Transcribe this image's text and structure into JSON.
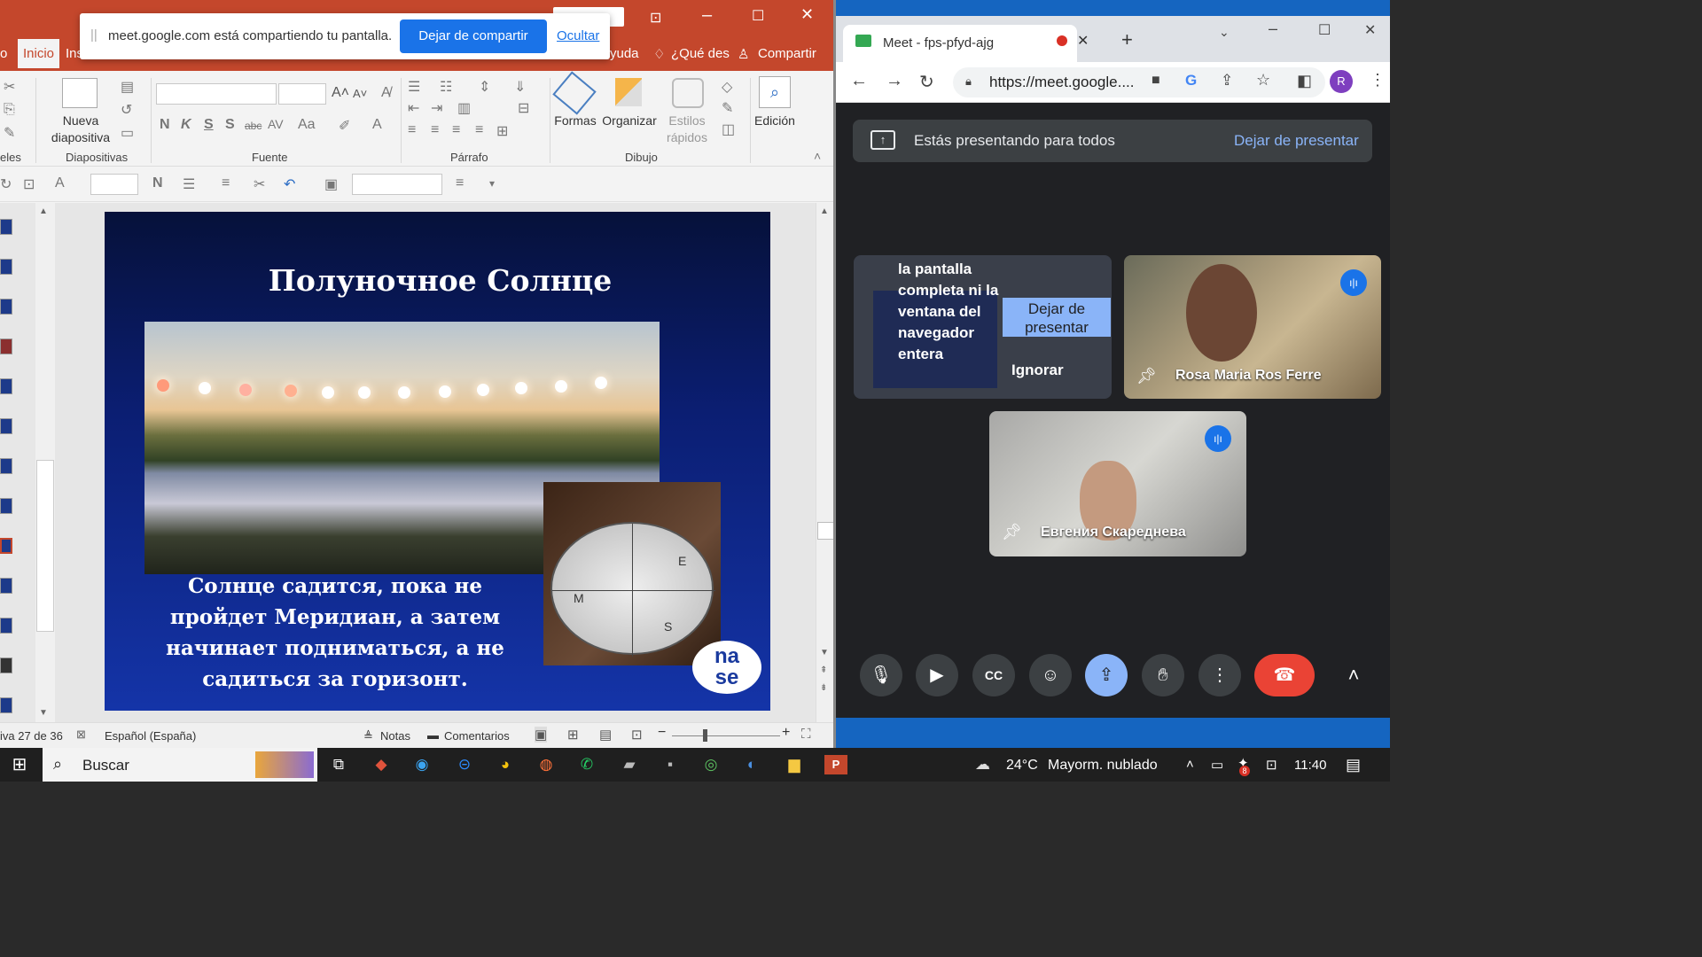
{
  "share_banner": {
    "message": "meet.google.com está compartiendo tu pantalla.",
    "stop_label": "Dejar de compartir",
    "hide_label": "Ocultar"
  },
  "ppt": {
    "tabs": [
      "o",
      "Inicio",
      "Ins",
      "yuda",
      "¿Qué des",
      "Compartir"
    ],
    "ribbon": {
      "new_slide": "Nueva diapositiva",
      "groups": [
        "eles",
        "Diapositivas",
        "Fuente",
        "Párrafo",
        "Dibujo"
      ],
      "shapes": "Formas",
      "arrange": "Organizar",
      "quick_styles": "Estilos rápidos",
      "editing": "Edición",
      "font_buttons": [
        "N",
        "K",
        "S",
        "S",
        "abc",
        "AV",
        "Aa",
        "A"
      ]
    },
    "slide": {
      "title": "Полуночное Солнце",
      "text": "Солнце садится, пока не пройдет Меридиан, а затем начинает подниматься, а не садиться за горизонт.",
      "logo_top": "na",
      "logo_bottom": "se",
      "compass_letters": [
        "E",
        "M",
        "S"
      ]
    },
    "status": {
      "slide_counter": "iva 27 de 36",
      "language": "Español (España)",
      "notes": "Notas",
      "comments": "Comentarios"
    }
  },
  "chrome": {
    "tab_title": "Meet - fps-pfyd-ajg",
    "url": "https://meet.google....",
    "profile": "R"
  },
  "meet": {
    "presenting_text": "Estás presentando para todos",
    "stop_presenting": "Dejar de presentar",
    "screen_tile": {
      "text": "la pantalla completa ni la ventana del navegador entera",
      "button": "Dejar de presentar",
      "ignore": "Ignorar"
    },
    "participants": [
      {
        "name": "Rosa Maria Ros Ferre"
      },
      {
        "name": "Евгения Скареднева"
      }
    ]
  },
  "taskbar": {
    "search_placeholder": "Buscar",
    "temperature": "24°C",
    "weather": "Mayorm. nublado",
    "time": "11:40",
    "notif_count": "8"
  }
}
